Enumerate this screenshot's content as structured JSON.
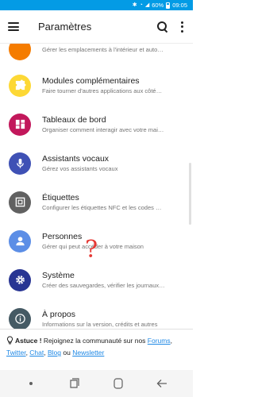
{
  "status_bar": {
    "battery_percent": "60%",
    "time": "09:05"
  },
  "app_bar": {
    "title": "Paramètres"
  },
  "items": [
    {
      "title": "",
      "subtitle": "Gérer les emplacements à l'intérieur et auto…",
      "color": "#f57c00",
      "icon": "location-icon"
    },
    {
      "title": "Modules complémentaires",
      "subtitle": "Faire tourner d'autres applications aux côté…",
      "color": "#fdd835",
      "icon": "puzzle-icon"
    },
    {
      "title": "Tableaux de bord",
      "subtitle": "Organiser comment interagir avec votre mai…",
      "color": "#c2185b",
      "icon": "dashboard-icon"
    },
    {
      "title": "Assistants vocaux",
      "subtitle": "Gérez vos assistants vocaux",
      "color": "#3f51b5",
      "icon": "microphone-icon"
    },
    {
      "title": "Étiquettes",
      "subtitle": "Configurer les étiquettes NFC et les codes …",
      "color": "#616161",
      "icon": "nfc-icon"
    },
    {
      "title": "Personnes",
      "subtitle": "Gérer qui peut accéder à votre maison",
      "color": "#5c8ee6",
      "icon": "person-icon"
    },
    {
      "title": "Système",
      "subtitle": "Créer des sauvegardes, vérifier les journaux…",
      "color": "#283593",
      "icon": "gear-icon"
    },
    {
      "title": "À propos",
      "subtitle": "Informations sur la version, crédits et autres",
      "color": "#455a64",
      "icon": "info-icon"
    }
  ],
  "annotation": {
    "text": "?",
    "color": "#e53935"
  },
  "tip": {
    "label": "Astuce !",
    "text_before": " Rejoignez la communauté sur nos ",
    "link_forums": "Forums",
    "sep1": ",",
    "link_twitter": "Twitter",
    "sep2": ", ",
    "link_chat": "Chat",
    "sep3": ", ",
    "link_blog": "Blog",
    "text_ou": " ou ",
    "link_newsletter": "Newsletter"
  },
  "nav_bar": {
    "buttons": [
      "assistant-dot",
      "recent-apps",
      "home",
      "back"
    ]
  }
}
